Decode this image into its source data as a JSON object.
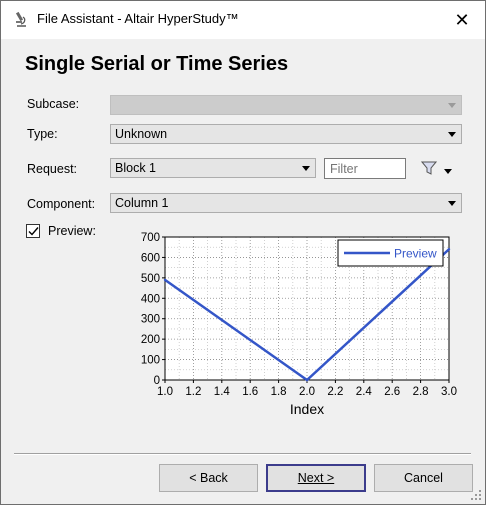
{
  "window": {
    "title": "File Assistant - Altair HyperStudy™",
    "close_glyph": "✕"
  },
  "heading": "Single Serial or Time Series",
  "fields": {
    "subcase": {
      "label": "Subcase:",
      "value": ""
    },
    "type": {
      "label": "Type:",
      "value": "Unknown"
    },
    "request": {
      "label": "Request:",
      "value": "Block 1",
      "filter_placeholder": "Filter"
    },
    "component": {
      "label": "Component:",
      "value": "Column 1"
    },
    "preview": {
      "label": "Preview:",
      "checked": true
    }
  },
  "chart_data": {
    "type": "line",
    "title": "",
    "xlabel": "Index",
    "ylabel": "",
    "xlim": [
      1.0,
      3.0
    ],
    "ylim": [
      0,
      700
    ],
    "xticks": [
      "1.0",
      "1.2",
      "1.4",
      "1.6",
      "1.8",
      "2.0",
      "2.2",
      "2.4",
      "2.6",
      "2.8",
      "3.0"
    ],
    "yticks": [
      "0",
      "100",
      "200",
      "300",
      "400",
      "500",
      "600",
      "700"
    ],
    "grid": true,
    "legend_position": "top-right",
    "series": [
      {
        "name": "Preview",
        "color": "#3456c8",
        "x": [
          1.0,
          2.0,
          3.0
        ],
        "y": [
          490,
          0,
          640
        ]
      }
    ]
  },
  "buttons": {
    "back": "< Back",
    "next": "Next >",
    "cancel": "Cancel"
  },
  "icons": {
    "title": "microscope-icon",
    "filter": "funnel-icon",
    "filter_menu": "chevron-down-icon",
    "check": "checkmark-icon",
    "grip": "resize-grip-icon"
  }
}
